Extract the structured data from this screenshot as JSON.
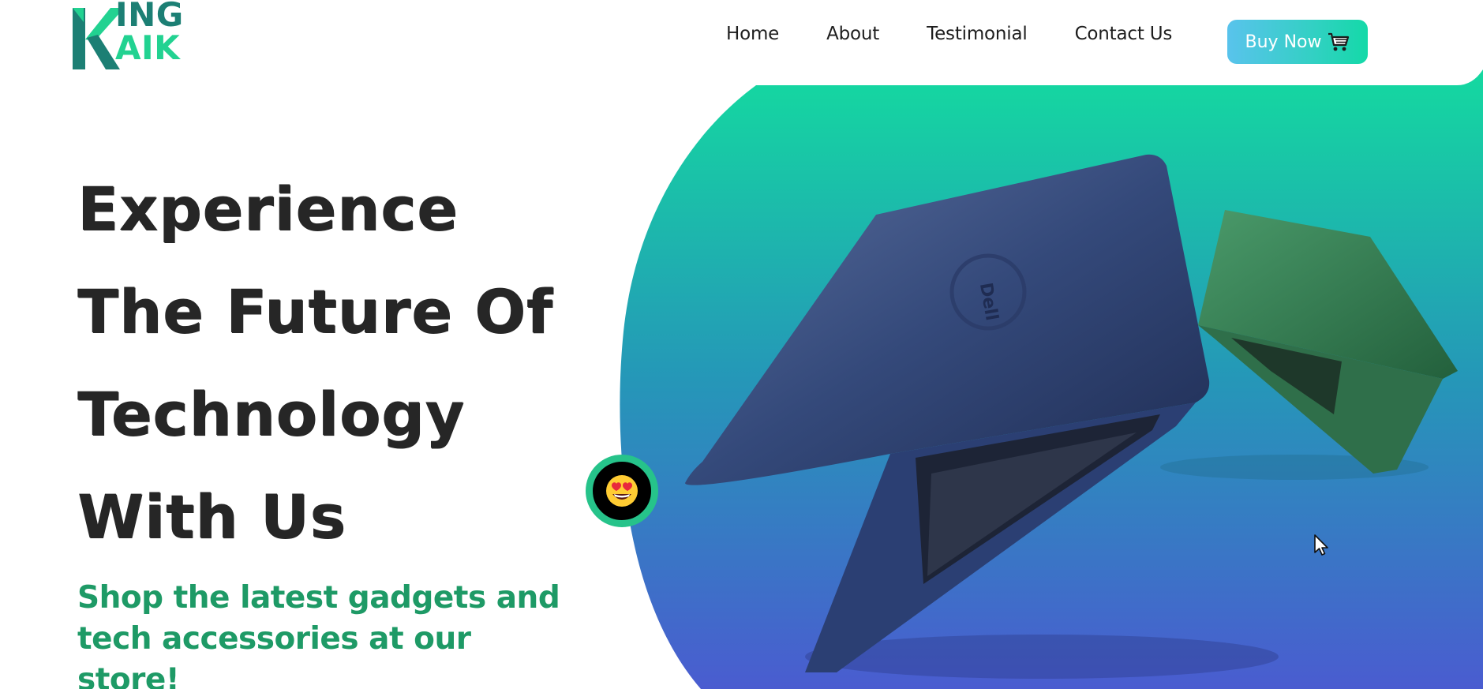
{
  "brand": {
    "logo_letter": "K",
    "logo_rest": "ING",
    "logo_accent": "AIK"
  },
  "nav": {
    "items": [
      {
        "label": "Home"
      },
      {
        "label": "About"
      },
      {
        "label": "Testimonial"
      },
      {
        "label": "Contact Us"
      }
    ],
    "cta_label": "Buy Now",
    "cta_icon": "shopping-cart-icon"
  },
  "hero": {
    "headline_lines": [
      "Experience",
      "The Future Of",
      "Technology",
      "With Us"
    ],
    "tagline_line1": "Shop the latest gadgets and",
    "tagline_line2": "tech accessories at our store!",
    "laptop_brand": "Dell",
    "badge_icon": "heart-eyes-emoji-icon"
  },
  "colors": {
    "accent_green": "#1e9a66",
    "gradient_top": "#14d9a0",
    "gradient_bottom": "#4a5fcf",
    "button_gradient_start": "#59c3ec",
    "button_gradient_end": "#14d9a8"
  }
}
